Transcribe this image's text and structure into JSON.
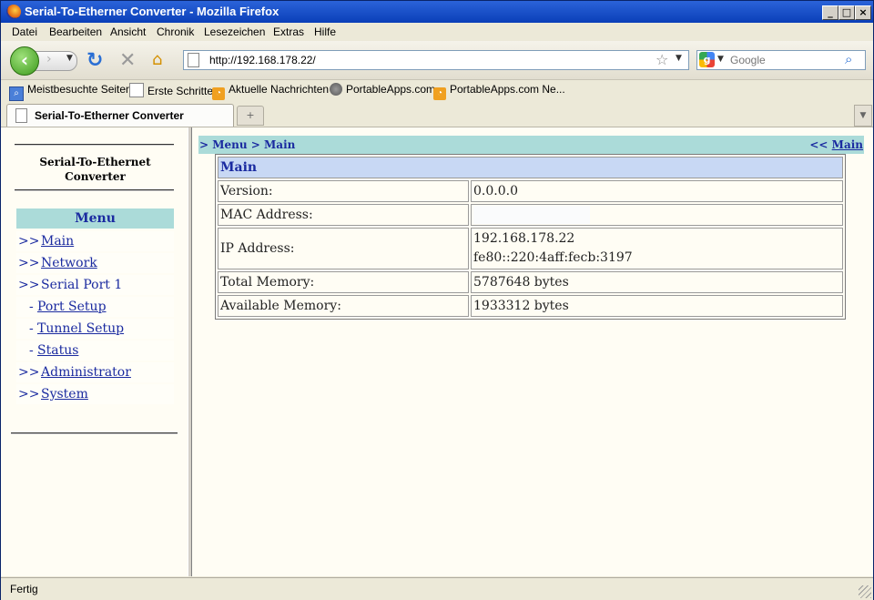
{
  "window": {
    "title": "Serial-To-Etherner Converter - Mozilla Firefox"
  },
  "menubar": [
    "Datei",
    "Bearbeiten",
    "Ansicht",
    "Chronik",
    "Lesezeichen",
    "Extras",
    "Hilfe"
  ],
  "navbar": {
    "url": "http://192.168.178.22/",
    "search_placeholder": "Google"
  },
  "bookmarks": [
    "Meistbesuchte Seiten",
    "Erste Schritte",
    "Aktuelle Nachrichten",
    "PortableApps.com",
    "PortableApps.com Ne..."
  ],
  "tabs": [
    {
      "label": "Serial-To-Etherner Converter"
    }
  ],
  "sidebar": {
    "brand_line1": "Serial-To-Ethernet",
    "brand_line2": "Converter",
    "menu_title": "Menu",
    "items": [
      {
        "prefix": ">>",
        "label": "Main"
      },
      {
        "prefix": ">>",
        "label": "Network"
      },
      {
        "prefix": ">>",
        "label": "Serial Port 1"
      },
      {
        "prefix": "-",
        "label": "Port Setup"
      },
      {
        "prefix": "-",
        "label": "Tunnel Setup"
      },
      {
        "prefix": "-",
        "label": "Status"
      },
      {
        "prefix": ">>",
        "label": "Administrator"
      },
      {
        "prefix": ">>",
        "label": "System"
      }
    ]
  },
  "breadcrumb": {
    "left": "> Menu > Main",
    "right_prefix": "<<",
    "right_link": "Main"
  },
  "info_table": {
    "title": "Main",
    "rows": [
      {
        "label": "Version:",
        "value": "0.0.0.0"
      },
      {
        "label": "MAC Address:",
        "value": ""
      },
      {
        "label": "IP Address:",
        "value": "192.168.178.22",
        "value2": "fe80::220:4aff:fecb:3197"
      },
      {
        "label": "Total Memory:",
        "value": "5787648 bytes"
      },
      {
        "label": "Available Memory:",
        "value": "1933312 bytes"
      }
    ]
  },
  "status": {
    "text": "Fertig"
  }
}
